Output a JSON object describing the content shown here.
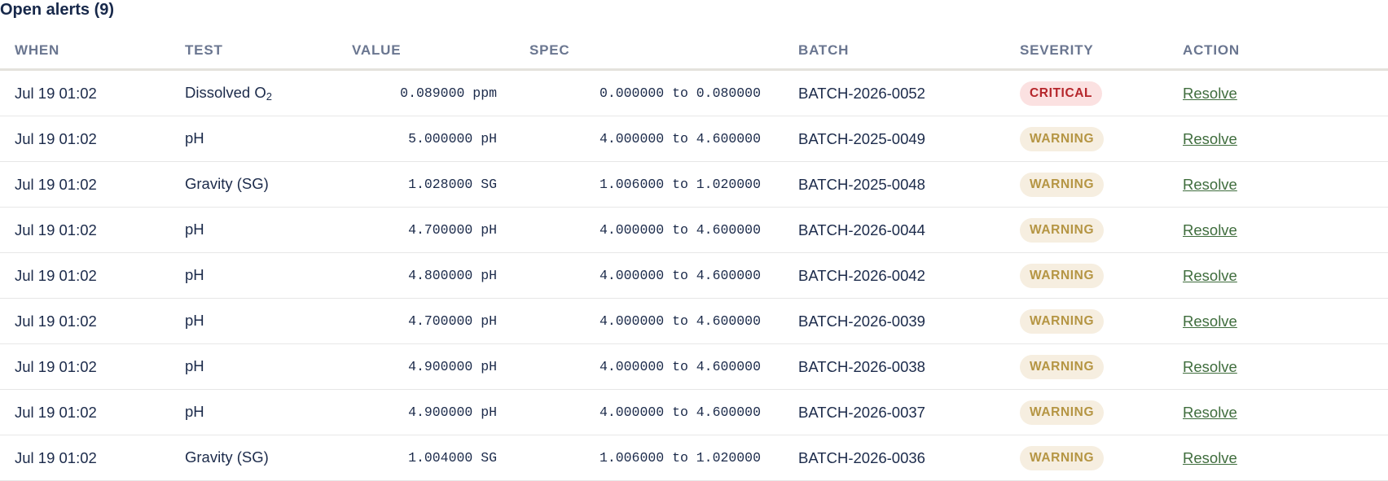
{
  "title": "Open alerts (9)",
  "columns": {
    "when": "WHEN",
    "test": "TEST",
    "value": "VALUE",
    "spec": "SPEC",
    "batch": "BATCH",
    "severity": "SEVERITY",
    "action": "ACTION"
  },
  "colors": {
    "critical_text": "#b5262b",
    "critical_bg": "#fbe1e1",
    "warning_text": "#b59543",
    "warning_bg": "#f6eee0",
    "link": "#3f6d3d",
    "title": "#17284a"
  },
  "rows": [
    {
      "when": "Jul 19 01:02",
      "test": "Dissolved O",
      "test_sub": "2",
      "value": "0.089000 ppm",
      "spec": "0.000000 to 0.080000",
      "batch": "BATCH-2026-0052",
      "severity": "CRITICAL",
      "severity_level": "critical",
      "action": "Resolve"
    },
    {
      "when": "Jul 19 01:02",
      "test": "pH",
      "test_sub": "",
      "value": "5.000000 pH",
      "spec": "4.000000 to 4.600000",
      "batch": "BATCH-2025-0049",
      "severity": "WARNING",
      "severity_level": "warning",
      "action": "Resolve"
    },
    {
      "when": "Jul 19 01:02",
      "test": "Gravity (SG)",
      "test_sub": "",
      "value": "1.028000 SG",
      "spec": "1.006000 to 1.020000",
      "batch": "BATCH-2025-0048",
      "severity": "WARNING",
      "severity_level": "warning",
      "action": "Resolve"
    },
    {
      "when": "Jul 19 01:02",
      "test": "pH",
      "test_sub": "",
      "value": "4.700000 pH",
      "spec": "4.000000 to 4.600000",
      "batch": "BATCH-2026-0044",
      "severity": "WARNING",
      "severity_level": "warning",
      "action": "Resolve"
    },
    {
      "when": "Jul 19 01:02",
      "test": "pH",
      "test_sub": "",
      "value": "4.800000 pH",
      "spec": "4.000000 to 4.600000",
      "batch": "BATCH-2026-0042",
      "severity": "WARNING",
      "severity_level": "warning",
      "action": "Resolve"
    },
    {
      "when": "Jul 19 01:02",
      "test": "pH",
      "test_sub": "",
      "value": "4.700000 pH",
      "spec": "4.000000 to 4.600000",
      "batch": "BATCH-2026-0039",
      "severity": "WARNING",
      "severity_level": "warning",
      "action": "Resolve"
    },
    {
      "when": "Jul 19 01:02",
      "test": "pH",
      "test_sub": "",
      "value": "4.900000 pH",
      "spec": "4.000000 to 4.600000",
      "batch": "BATCH-2026-0038",
      "severity": "WARNING",
      "severity_level": "warning",
      "action": "Resolve"
    },
    {
      "when": "Jul 19 01:02",
      "test": "pH",
      "test_sub": "",
      "value": "4.900000 pH",
      "spec": "4.000000 to 4.600000",
      "batch": "BATCH-2026-0037",
      "severity": "WARNING",
      "severity_level": "warning",
      "action": "Resolve"
    },
    {
      "when": "Jul 19 01:02",
      "test": "Gravity (SG)",
      "test_sub": "",
      "value": "1.004000 SG",
      "spec": "1.006000 to 1.020000",
      "batch": "BATCH-2026-0036",
      "severity": "WARNING",
      "severity_level": "warning",
      "action": "Resolve"
    }
  ]
}
